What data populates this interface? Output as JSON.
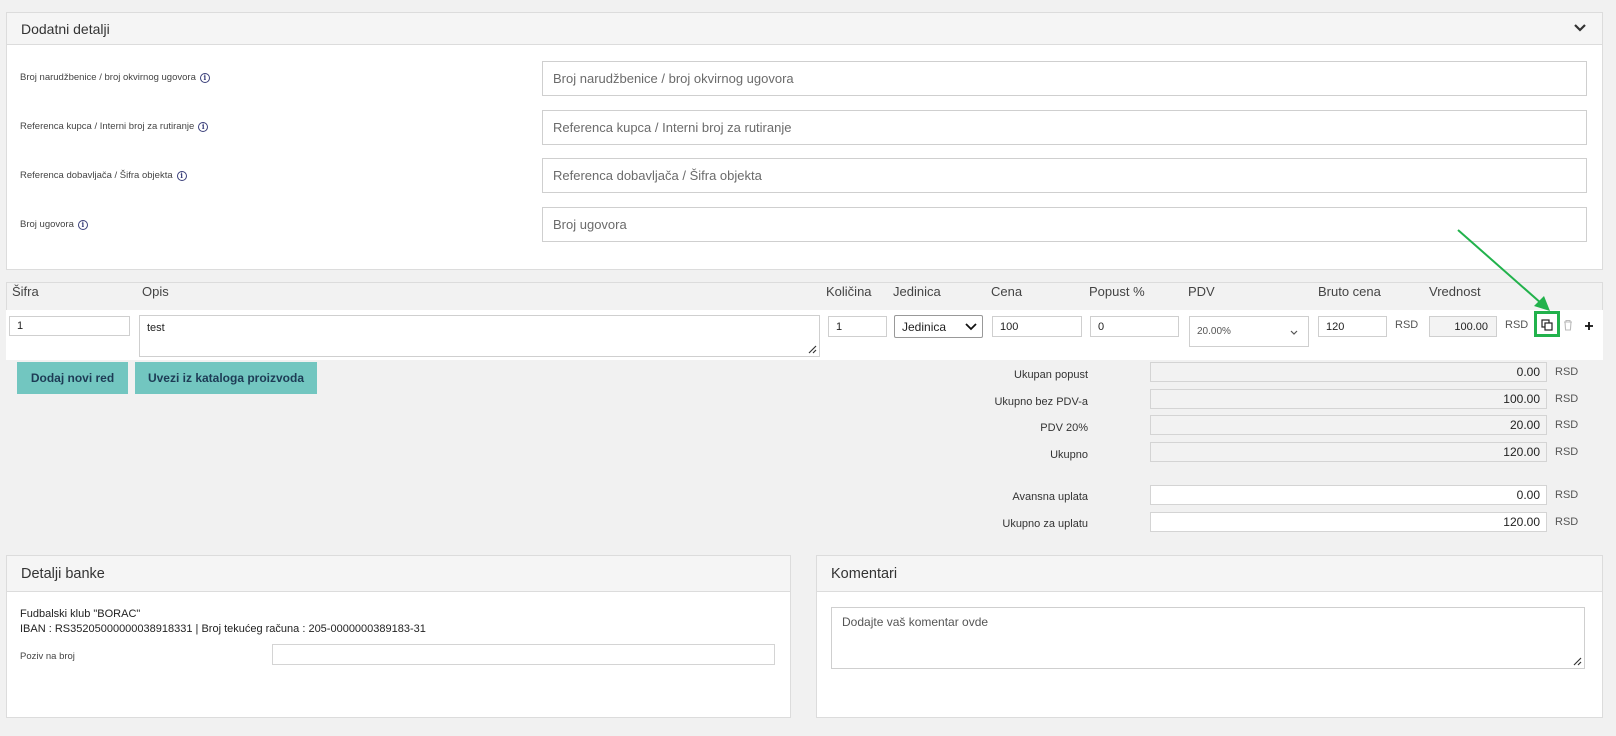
{
  "additional": {
    "title": "Dodatni detalji",
    "fields": [
      {
        "label": "Broj narudžbenice / broj okvirnog ugovora",
        "placeholder": "Broj narudžbenice / broj okvirnog ugovora"
      },
      {
        "label": "Referenca kupca / Interni broj za rutiranje",
        "placeholder": "Referenca kupca / Interni broj za rutiranje"
      },
      {
        "label": "Referenca dobavljača / Šifra objekta",
        "placeholder": "Referenca dobavljača / Šifra objekta"
      },
      {
        "label": "Broj ugovora",
        "placeholder": "Broj ugovora"
      }
    ]
  },
  "table": {
    "headers": {
      "sifra": "Šifra",
      "opis": "Opis",
      "kolicina": "Količina",
      "jedinica": "Jedinica",
      "cena": "Cena",
      "popust": "Popust %",
      "pdv": "PDV",
      "bruto": "Bruto cena",
      "vrednost": "Vrednost"
    },
    "row": {
      "sifra": "1",
      "opis": "test",
      "kolicina": "1",
      "jedinica": "Jedinica",
      "cena": "100",
      "popust": "0",
      "pdv": "20.00%",
      "bruto": "120",
      "bruto_currency": "RSD",
      "vrednost": "100.00",
      "vrednost_currency": "RSD"
    }
  },
  "buttons": {
    "add_row": "Dodaj novi red",
    "import_catalog": "Uvezi iz kataloga proizvoda"
  },
  "summary": {
    "currency": "RSD",
    "rows": [
      {
        "label": "Ukupan popust",
        "value": "0.00"
      },
      {
        "label": "Ukupno bez PDV-a",
        "value": "100.00"
      },
      {
        "label": "PDV 20%",
        "value": "20.00"
      },
      {
        "label": "Ukupno",
        "value": "120.00"
      },
      {
        "label": "Avansna uplata",
        "value": "0.00"
      },
      {
        "label": "Ukupno za uplatu",
        "value": "120.00"
      }
    ]
  },
  "bank": {
    "title": "Detalji banke",
    "name": "Fudbalski klub \"BORAC\"",
    "iban_line": "IBAN : RS35205000000038918331 | Broj tekućeg računa : 205-0000000389183-31",
    "reference_label": "Poziv na broj"
  },
  "comments": {
    "title": "Komentari",
    "placeholder": "Dodajte vaš komentar ovde"
  },
  "colors": {
    "accent_button": "#72c6c0",
    "highlight": "#22b24c",
    "info_icon": "#3a3f7a"
  }
}
